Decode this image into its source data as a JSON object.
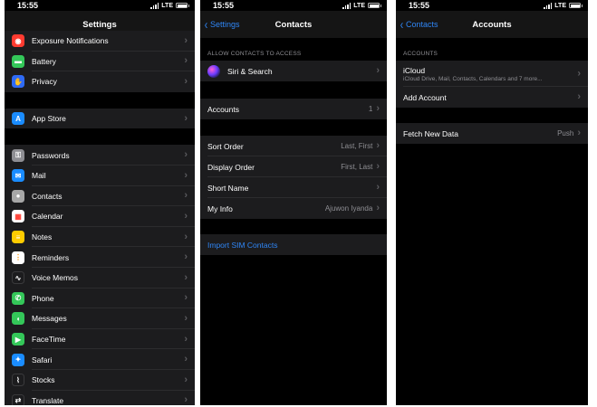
{
  "status": {
    "time": "15:55",
    "network": "LTE"
  },
  "settings": {
    "title": "Settings",
    "items": [
      {
        "label": "Exposure Notifications",
        "icon": "exposure-icon",
        "color": "#ff3b30"
      },
      {
        "label": "Battery",
        "icon": "battery-icon",
        "color": "#34c759"
      },
      {
        "label": "Privacy",
        "icon": "hand-icon",
        "color": "#2f6bf6"
      },
      {
        "label": "App Store",
        "icon": "appstore-icon",
        "color": "#1a8cff"
      },
      {
        "label": "Passwords",
        "icon": "key-icon",
        "color": "#8e8e93"
      },
      {
        "label": "Mail",
        "icon": "mail-icon",
        "color": "#1a8cff"
      },
      {
        "label": "Contacts",
        "icon": "contacts-icon",
        "color": "#a7a7a7"
      },
      {
        "label": "Calendar",
        "icon": "calendar-icon",
        "color": "#ffffff"
      },
      {
        "label": "Notes",
        "icon": "notes-icon",
        "color": "#ffcc00"
      },
      {
        "label": "Reminders",
        "icon": "reminders-icon",
        "color": "#ffffff"
      },
      {
        "label": "Voice Memos",
        "icon": "voice-memos-icon",
        "color": "#1c1c1e"
      },
      {
        "label": "Phone",
        "icon": "phone-icon",
        "color": "#34c759"
      },
      {
        "label": "Messages",
        "icon": "messages-icon",
        "color": "#34c759"
      },
      {
        "label": "FaceTime",
        "icon": "facetime-icon",
        "color": "#34c759"
      },
      {
        "label": "Safari",
        "icon": "safari-icon",
        "color": "#1a8cff"
      },
      {
        "label": "Stocks",
        "icon": "stocks-icon",
        "color": "#1c1c1e"
      },
      {
        "label": "Translate",
        "icon": "translate-icon",
        "color": "#1c1c1e"
      }
    ]
  },
  "contacts": {
    "back": "Settings",
    "title": "Contacts",
    "allow_header": "ALLOW CONTACTS TO ACCESS",
    "siri": "Siri & Search",
    "accounts_label": "Accounts",
    "accounts_value": "1",
    "sort_order": {
      "label": "Sort Order",
      "value": "Last, First"
    },
    "display_order": {
      "label": "Display Order",
      "value": "First, Last"
    },
    "short_name": {
      "label": "Short Name"
    },
    "my_info": {
      "label": "My Info",
      "value": "Ajuwon Iyanda"
    },
    "import_sim": "Import SIM Contacts"
  },
  "accounts": {
    "back": "Contacts",
    "title": "Accounts",
    "header": "ACCOUNTS",
    "icloud": {
      "label": "iCloud",
      "sub": "iCloud Drive, Mail, Contacts, Calendars and 7 more..."
    },
    "add_account": "Add Account",
    "fetch": {
      "label": "Fetch New Data",
      "value": "Push"
    }
  },
  "colors": {
    "accent": "#2f86f6",
    "row_bg": "#1c1c1e",
    "nav_bg": "#151515"
  }
}
